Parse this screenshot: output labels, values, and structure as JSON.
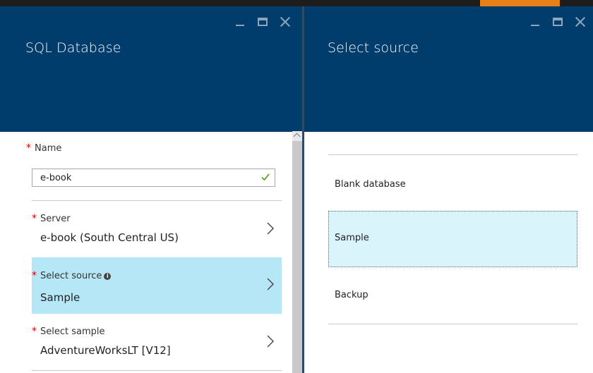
{
  "left_blade": {
    "title": "SQL Database",
    "fields": {
      "name": {
        "label": "Name",
        "value": "e-book"
      },
      "server": {
        "label": "Server",
        "value": "e-book (South Central US)"
      },
      "source": {
        "label": "Select source",
        "value": "Sample"
      },
      "sample": {
        "label": "Select sample",
        "value": "AdventureWorksLT [V12]"
      }
    },
    "required_mark": "*"
  },
  "right_blade": {
    "title": "Select source",
    "options": [
      "Blank database",
      "Sample",
      "Backup"
    ],
    "selected": "Sample"
  },
  "colors": {
    "header": "#003c6c",
    "selected_picker": "#b6e7f7",
    "selected_option": "#daf4fc",
    "accent": "#e8801a"
  }
}
